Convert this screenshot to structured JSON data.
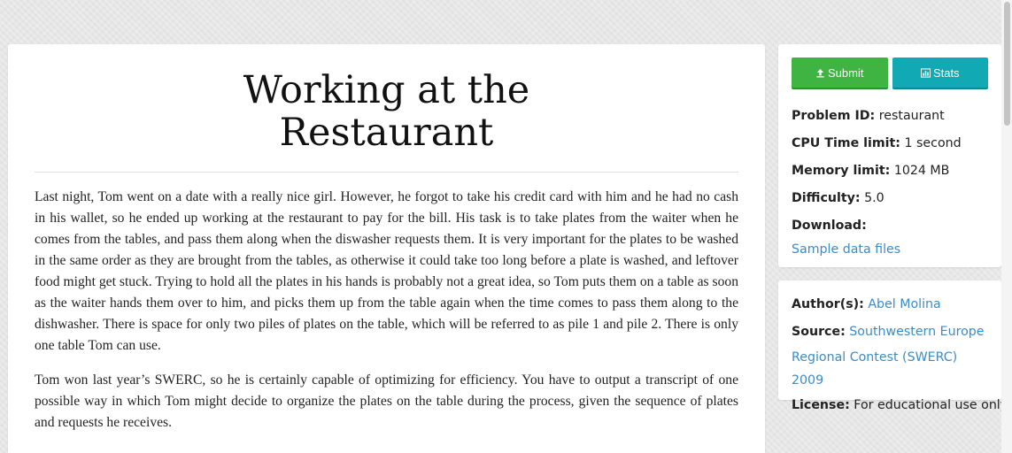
{
  "problem": {
    "title_line1": "Working at the",
    "title_line2": "Restaurant",
    "paragraphs": [
      "Last night, Tom went on a date with a really nice girl. However, he forgot to take his credit card with him and he had no cash in his wallet, so he ended up working at the restaurant to pay for the bill. His task is to take plates from the waiter when he comes from the tables, and pass them along when the diswasher requests them. It is very important for the plates to be washed in the same order as they are brought from the tables, as otherwise it could take too long before a plate is washed, and leftover food might get stuck. Trying to hold all the plates in his hands is probably not a great idea, so Tom puts them on a table as soon as the waiter hands them over to him, and picks them up from the table again when the time comes to pass them along to the dishwasher. There is space for only two piles of plates on the table, which will be referred to as pile 1 and pile 2. There is only one table Tom can use.",
      "Tom won last year’s SWERC, so he is certainly capable of optimizing for efficiency. You have to output a transcript of one possible way in which Tom might decide to organize the plates on the table during the process, given the sequence of plates and requests he receives."
    ]
  },
  "sidebar": {
    "submit_label": "Submit",
    "stats_label": "Stats",
    "submit_icon": "upload-icon",
    "stats_icon": "bar-chart-icon",
    "submit_color": "#3fb443",
    "stats_color": "#10a9b4",
    "problem_id_label": "Problem ID:",
    "problem_id": "restaurant",
    "cpu_label": "CPU Time limit:",
    "cpu_value": "1 second",
    "memory_label": "Memory limit:",
    "memory_value": "1024 MB",
    "difficulty_label": "Difficulty:",
    "difficulty_value": "5.0",
    "download_label": "Download:",
    "download_link": "Sample data files",
    "authors_label": "Author(s):",
    "authors_value": "Abel Molina",
    "source_label": "Source:",
    "source_line1": "Southwestern Europe",
    "source_line2": "Regional Contest (SWERC) 2009",
    "license_label": "License:",
    "license_value": "For educational use only"
  }
}
